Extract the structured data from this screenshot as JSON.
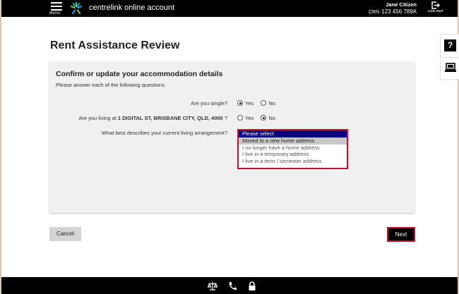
{
  "header": {
    "menu_label": "MENU",
    "brand": "centrelink online account",
    "user_name": "Jane Citizen",
    "crn_key": "CRN",
    "crn_value": "123 456 789A",
    "logout_label": "LOG OUT"
  },
  "side_tools": {
    "help_label": "?"
  },
  "page": {
    "title": "Rent Assistance Review"
  },
  "panel": {
    "title": "Confirm or update your accommodation details",
    "subtitle": "Please answer each of the following questions."
  },
  "questions": {
    "single": {
      "label": "Are you single?",
      "options": [
        "Yes",
        "No"
      ],
      "selected": "Yes"
    },
    "living": {
      "label_prefix": "Are you living at",
      "address": "1 DIGITAL ST, BRISBANE CITY, QLD, 4000",
      "label_suffix": "?",
      "options": [
        "Yes",
        "No"
      ],
      "selected": "No"
    },
    "arrangement": {
      "label": "What best describes your current living arrangement?",
      "options": [
        "Please select",
        "Moved to a new home address",
        "I no longer have a home address",
        "I live in a temporary address",
        "I live in a term / semester address"
      ],
      "selected": "Please select",
      "highlighted": "Moved to a new home address"
    }
  },
  "actions": {
    "cancel_label": "Cancel",
    "next_label": "Next"
  },
  "colors": {
    "header_bg": "#000000",
    "accent_red": "#c8102e",
    "selection_blue": "#000080",
    "panel_bg": "#f0f0f0"
  }
}
